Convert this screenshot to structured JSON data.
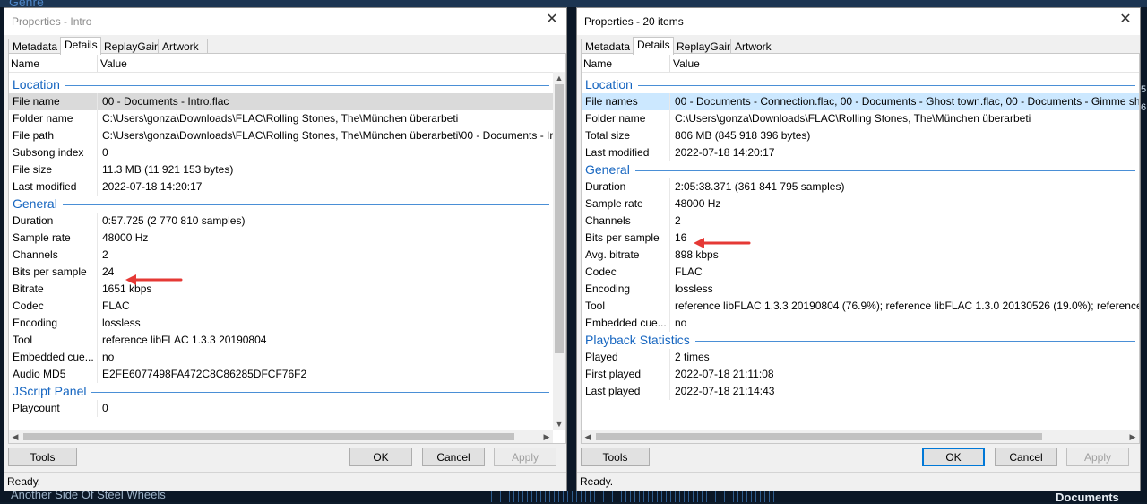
{
  "background": {
    "genre_label": "Genre",
    "song_label": "Another Side Of Steel Wheels",
    "docs_label": "Documents",
    "edge_digits": [
      "5",
      "6"
    ]
  },
  "left_window": {
    "title": "Properties - Intro",
    "tabs": [
      "Metadata",
      "Details",
      "ReplayGain",
      "Artwork"
    ],
    "active_tab": "Details",
    "columns": {
      "name": "Name",
      "value": "Value"
    },
    "sections": [
      {
        "title": "Location",
        "rows": [
          {
            "name": "File name",
            "value": "00 - Documents - Intro.flac"
          },
          {
            "name": "Folder name",
            "value": "C:\\Users\\gonza\\Downloads\\FLAC\\Rolling Stones, The\\München überarbeti"
          },
          {
            "name": "File path",
            "value": "C:\\Users\\gonza\\Downloads\\FLAC\\Rolling Stones, The\\München überarbeti\\00 - Documents - Int"
          },
          {
            "name": "Subsong index",
            "value": "0"
          },
          {
            "name": "File size",
            "value": "11.3 MB (11 921 153 bytes)"
          },
          {
            "name": "Last modified",
            "value": "2022-07-18 14:20:17"
          }
        ]
      },
      {
        "title": "General",
        "rows": [
          {
            "name": "Duration",
            "value": "0:57.725 (2 770 810 samples)"
          },
          {
            "name": "Sample rate",
            "value": "48000 Hz"
          },
          {
            "name": "Channels",
            "value": "2"
          },
          {
            "name": "Bits per sample",
            "value": "24"
          },
          {
            "name": "Bitrate",
            "value": "1651 kbps"
          },
          {
            "name": "Codec",
            "value": "FLAC"
          },
          {
            "name": "Encoding",
            "value": "lossless"
          },
          {
            "name": "Tool",
            "value": "reference libFLAC 1.3.3 20190804"
          },
          {
            "name": "Embedded cue...",
            "value": "no"
          },
          {
            "name": "Audio MD5",
            "value": "E2FE6077498FA472C8C86285DFCF76F2"
          }
        ]
      },
      {
        "title": "JScript Panel",
        "rows": [
          {
            "name": "Playcount",
            "value": "0"
          }
        ]
      }
    ],
    "buttons": {
      "tools": "Tools",
      "ok": "OK",
      "cancel": "Cancel",
      "apply": "Apply"
    },
    "status": "Ready."
  },
  "right_window": {
    "title": "Properties - 20 items",
    "tabs": [
      "Metadata",
      "Details",
      "ReplayGain",
      "Artwork"
    ],
    "active_tab": "Details",
    "columns": {
      "name": "Name",
      "value": "Value"
    },
    "sections": [
      {
        "title": "Location",
        "rows": [
          {
            "name": "File names",
            "value": "00 - Documents - Connection.flac, 00 - Documents - Ghost town.flac, 00 - Documents - Gimme shel"
          },
          {
            "name": "Folder name",
            "value": "C:\\Users\\gonza\\Downloads\\FLAC\\Rolling Stones, The\\München überarbeti"
          },
          {
            "name": "Total size",
            "value": "806 MB (845 918 396 bytes)"
          },
          {
            "name": "Last modified",
            "value": "2022-07-18 14:20:17"
          }
        ]
      },
      {
        "title": "General",
        "rows": [
          {
            "name": "Duration",
            "value": "2:05:38.371 (361 841 795 samples)"
          },
          {
            "name": "Sample rate",
            "value": "48000 Hz"
          },
          {
            "name": "Channels",
            "value": "2"
          },
          {
            "name": "Bits per sample",
            "value": "16"
          },
          {
            "name": "Avg. bitrate",
            "value": "898 kbps"
          },
          {
            "name": "Codec",
            "value": "FLAC"
          },
          {
            "name": "Encoding",
            "value": "lossless"
          },
          {
            "name": "Tool",
            "value": "reference libFLAC 1.3.3 20190804 (76.9%); reference libFLAC 1.3.0 20130526 (19.0%); reference libFLAC"
          },
          {
            "name": "Embedded cue...",
            "value": "no"
          }
        ]
      },
      {
        "title": "Playback Statistics",
        "rows": [
          {
            "name": "Played",
            "value": "2 times"
          },
          {
            "name": "First played",
            "value": "2022-07-18 21:11:08"
          },
          {
            "name": "Last played",
            "value": "2022-07-18 21:14:43"
          }
        ]
      }
    ],
    "buttons": {
      "tools": "Tools",
      "ok": "OK",
      "cancel": "Cancel",
      "apply": "Apply"
    },
    "status": "Ready."
  },
  "colors": {
    "section_title": "#1565c0",
    "annotation_arrow": "#e53935",
    "default_button_border": "#0078d7"
  }
}
